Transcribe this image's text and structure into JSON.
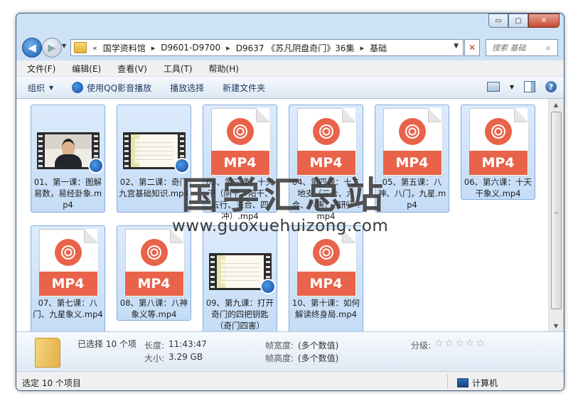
{
  "window": {
    "buttons": {
      "minimize": "▭",
      "maximize": "▢",
      "close": "✕"
    }
  },
  "address": {
    "overflow": "«",
    "crumbs": [
      "国学资料馆",
      "D9601-D9700",
      "D9637 《苏凡阴盘奇门》36集",
      "基础"
    ],
    "search_placeholder": "搜索 基础"
  },
  "menu": [
    "文件(F)",
    "编辑(E)",
    "查看(V)",
    "工具(T)",
    "帮助(H)"
  ],
  "toolbar": {
    "organize": "组织",
    "play_qq": "使用QQ影音播放",
    "play_selection": "播放选择",
    "new_folder": "新建文件夹"
  },
  "files": [
    {
      "name": "01、第一课：图解易数，易经卦象.mp4",
      "icon": "video-thumbnail-person"
    },
    {
      "name": "02、第二课：奇门九宫基础知识.mp4",
      "icon": "video-thumbnail-paper"
    },
    {
      "name": "03、第三课：十天干（阴干、阳干、五行、五合、四冲）.mp4",
      "icon": "mp4-icon"
    },
    {
      "name": "04、第四课：十二地支（三合、六合、六害、相刑）.mp4",
      "icon": "mp4-icon"
    },
    {
      "name": "05、第五课：八神、八门，九星.mp4",
      "icon": "mp4-icon"
    },
    {
      "name": "06、第六课：十天干象义.mp4",
      "icon": "mp4-icon"
    },
    {
      "name": "07、第七课：八门、九星象义.mp4",
      "icon": "mp4-icon"
    },
    {
      "name": "08、第八课：八神象义等.mp4",
      "icon": "mp4-icon"
    },
    {
      "name": "09、第九课：打开奇门的四把钥匙（奇门四害）",
      "icon": "video-thumbnail-paper"
    },
    {
      "name": "10、第十课：如何解读终身局.mp4",
      "icon": "mp4-icon"
    }
  ],
  "mp4_label": "MP4",
  "watermark": {
    "title": "国学汇总站",
    "url": "www.guoxuehuizong.com"
  },
  "details": {
    "selected": "已选择 10 个项",
    "length_label": "长度:",
    "length_value": "11:43:47",
    "size_label": "大小:",
    "size_value": "3.29 GB",
    "width_label": "帧宽度:",
    "width_value": "(多个数值)",
    "height_label": "帧高度:",
    "height_value": "(多个数值)",
    "rating_label": "分级:",
    "rating_stars": "☆☆☆☆☆"
  },
  "status": {
    "selected": "选定 10 个项目",
    "location": "计算机"
  },
  "colors": {
    "accent": "#1d5fb0",
    "mp4": "#e8634a",
    "selection": "#cfe3fa"
  }
}
